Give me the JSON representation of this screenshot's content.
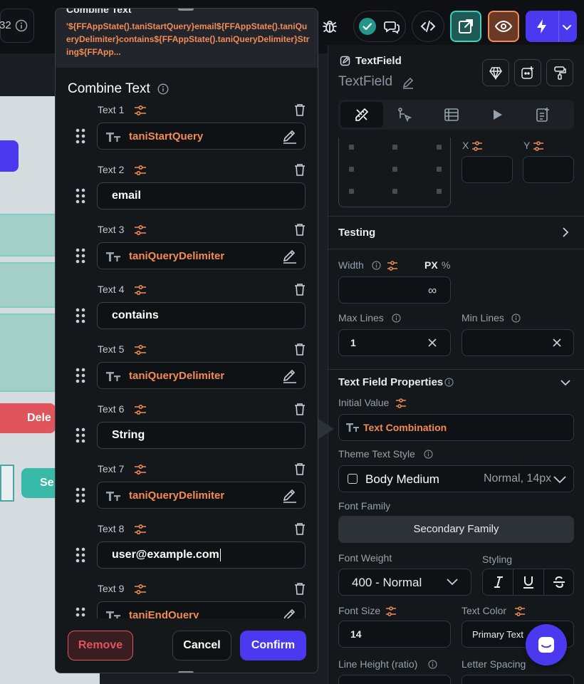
{
  "toolbar": {
    "partial_label": "32"
  },
  "dialog": {
    "preview_title": "Combine Text",
    "preview_code": "'${FFAppState().taniStartQuery}email${FFAppState().taniQueryDelimiter}contains${FFAppState().taniQueryDelimiter}String${FFApp...",
    "title": "Combine Text",
    "items": [
      {
        "label": "Text 1",
        "type": "variable",
        "value": "taniStartQuery"
      },
      {
        "label": "Text 2",
        "type": "text",
        "value": "email"
      },
      {
        "label": "Text 3",
        "type": "variable",
        "value": "taniQueryDelimiter"
      },
      {
        "label": "Text 4",
        "type": "text",
        "value": "contains"
      },
      {
        "label": "Text 5",
        "type": "variable",
        "value": "taniQueryDelimiter"
      },
      {
        "label": "Text 6",
        "type": "text",
        "value": "String"
      },
      {
        "label": "Text 7",
        "type": "variable",
        "value": "taniQueryDelimiter"
      },
      {
        "label": "Text 8",
        "type": "text",
        "value": "user@example.com"
      },
      {
        "label": "Text 9",
        "type": "variable",
        "value": "taniEndQuery"
      }
    ],
    "remove_label": "Remove",
    "cancel_label": "Cancel",
    "confirm_label": "Confirm"
  },
  "canvas": {
    "delete_label": "Dele",
    "se_label": "Se"
  },
  "panel": {
    "widget_badge": "TextField",
    "widget_name": "TextField",
    "x_label": "X",
    "y_label": "Y",
    "testing": "Testing",
    "width_label": "Width",
    "px_label": "PX",
    "pct_label": "%",
    "width_value": "∞",
    "max_lines_label": "Max Lines",
    "max_lines_value": "1",
    "min_lines_label": "Min Lines",
    "min_lines_value": "",
    "tf_props": "Text Field Properties",
    "initial_value_label": "Initial Value",
    "initial_value": "Text Combination",
    "theme_style_label": "Theme Text Style",
    "theme_style": "Body Medium",
    "theme_style_meta": "Normal, 14px",
    "font_family_label": "Font Family",
    "font_family": "Secondary Family",
    "font_weight_label": "Font Weight",
    "font_weight": "400 - Normal",
    "styling_label": "Styling",
    "font_size_label": "Font Size",
    "font_size": "14",
    "text_color_label": "Text Color",
    "text_color": "Primary Text",
    "line_height_label": "Line Height (ratio)",
    "letter_spacing_label": "Letter Spacing"
  },
  "colors": {
    "accent": "#4b39ef",
    "orange": "#f28b55",
    "teal": "#39d2c0",
    "danger": "#e0545c"
  }
}
